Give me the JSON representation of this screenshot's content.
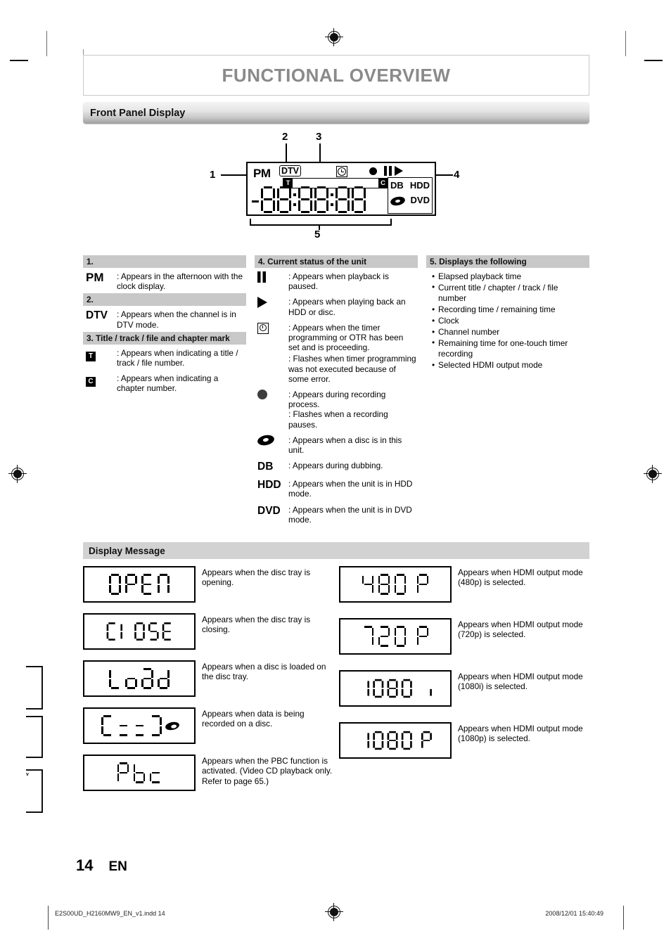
{
  "header": {
    "title": "FUNCTIONAL OVERVIEW",
    "section_bar": "Front Panel Display"
  },
  "diagram": {
    "callouts": [
      "1",
      "2",
      "3",
      "4",
      "5"
    ],
    "display": {
      "pm": "PM",
      "dtv": "DTV",
      "title_mark": "T",
      "chapter_mark": "C",
      "db": "DB",
      "hdd": "HDD",
      "dvd": "DVD",
      "icons": [
        "timer-icon",
        "record-icon",
        "pause-icon",
        "play-icon",
        "disc-icon"
      ]
    }
  },
  "legend": {
    "col1": {
      "sections": [
        {
          "heading": "1.",
          "rows": [
            {
              "symbol": "PM",
              "text": ": Appears in the afternoon with the clock display."
            }
          ]
        },
        {
          "heading": "2.",
          "rows": [
            {
              "symbol": "DTV",
              "text": ": Appears when the channel is in DTV mode."
            }
          ]
        },
        {
          "heading": "3. Title / track / file and chapter mark",
          "rows": [
            {
              "symbol": "T",
              "text": ": Appears when indicating a title / track / file number."
            },
            {
              "symbol": "C",
              "text": ": Appears when indicating a chapter number."
            }
          ]
        }
      ]
    },
    "col2": {
      "heading": "4. Current status of the unit",
      "rows": [
        {
          "icon": "pause-icon",
          "text": ": Appears when playback is paused."
        },
        {
          "icon": "play-icon",
          "text": ": Appears when playing back an HDD or disc."
        },
        {
          "icon": "timer-icon",
          "text": ": Appears when the timer programming or OTR has been set and is proceeding.",
          "text2": ": Flashes when timer programming was not executed because of some error."
        },
        {
          "icon": "record-icon",
          "text": ": Appears during recording process.",
          "text2": ": Flashes when a recording pauses."
        },
        {
          "icon": "disc-icon",
          "text": ": Appears when a disc is in this unit."
        },
        {
          "label": "DB",
          "text": ": Appears during dubbing."
        },
        {
          "label": "HDD",
          "text": ": Appears when the unit is in HDD mode."
        },
        {
          "label": "DVD",
          "text": ": Appears when the unit is in DVD mode."
        }
      ]
    },
    "col3": {
      "heading": "5. Displays the following",
      "items": [
        "Elapsed playback time",
        "Current title / chapter / track / file number",
        "Recording time / remaining time",
        "Clock",
        "Channel number",
        "Remaining time for one-touch timer recording",
        "Selected HDMI output mode"
      ]
    }
  },
  "display_message": {
    "heading": "Display Message",
    "left": [
      {
        "lcd": "OPEN",
        "text": "Appears when the disc tray is opening."
      },
      {
        "lcd": "CLOSE",
        "text": "Appears when the disc tray is closing."
      },
      {
        "lcd": "Load",
        "text": "Appears when a disc is loaded on the disc tray."
      },
      {
        "lcd": "C:::]",
        "text": "Appears when data is being recorded on a disc."
      },
      {
        "lcd": "Pbc",
        "text": "Appears when the PBC function is activated. (Video CD playback only. Refer to page 65.)"
      }
    ],
    "right": [
      {
        "lcd": "480 P",
        "text": "Appears when HDMI output mode (480p) is selected."
      },
      {
        "lcd": "720 P",
        "text": "Appears when HDMI output mode (720p) is selected."
      },
      {
        "lcd": "1080 i",
        "text": "Appears when HDMI output mode (1080i) is selected."
      },
      {
        "lcd": "1080 P",
        "text": "Appears when HDMI output mode (1080p) is selected."
      }
    ]
  },
  "page_footer": {
    "page_number": "14",
    "language": "EN",
    "file_name": "E2S00UD_H2160MW9_EN_v1.indd   14",
    "timestamp": "2008/12/01   15:40:49"
  }
}
